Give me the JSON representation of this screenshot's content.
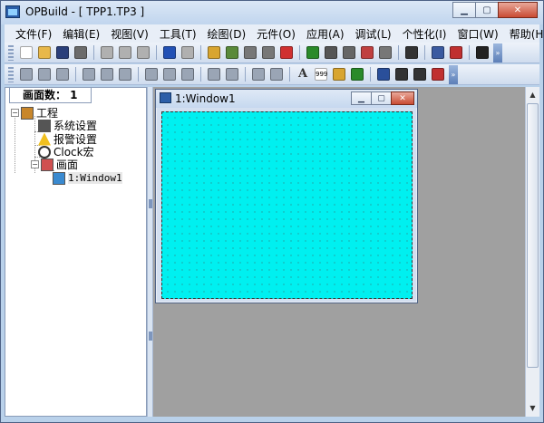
{
  "window": {
    "title": "OPBuild - [ TPP1.TP3 ]"
  },
  "window_controls": {
    "minimize": "▁",
    "maximize": "▢",
    "close": "✕"
  },
  "menu": [
    "文件(F)",
    "编辑(E)",
    "视图(V)",
    "工具(T)",
    "绘图(D)",
    "元件(O)",
    "应用(A)",
    "调试(L)",
    "个性化(I)",
    "窗口(W)",
    "帮助(H)"
  ],
  "toolbar1": {
    "buttons": [
      {
        "name": "new-file-icon",
        "color": "#ffffff"
      },
      {
        "name": "open-folder-icon",
        "color": "#e8b84a"
      },
      {
        "name": "save-icon",
        "color": "#2a3f7a"
      },
      {
        "name": "print-icon",
        "color": "#6b6b6b"
      },
      {
        "name": "cut-icon",
        "color": "#b0b0b0"
      },
      {
        "name": "copy-icon",
        "color": "#b0b0b0"
      },
      {
        "name": "paste-icon",
        "color": "#b0b0b0"
      },
      {
        "name": "undo-icon",
        "color": "#2251b5"
      },
      {
        "name": "redo-icon",
        "color": "#b0b0b0"
      },
      {
        "name": "component-a-icon",
        "color": "#d8a530"
      },
      {
        "name": "component-b-icon",
        "color": "#5a8a3a"
      },
      {
        "name": "component-c-icon",
        "color": "#777777"
      },
      {
        "name": "component-d-icon",
        "color": "#777777"
      },
      {
        "name": "delete-component-icon",
        "color": "#d03030"
      },
      {
        "name": "compile-icon",
        "color": "#2a8a2a"
      },
      {
        "name": "tools-icon",
        "color": "#555555"
      },
      {
        "name": "settings-a-icon",
        "color": "#666666"
      },
      {
        "name": "settings-b-icon",
        "color": "#c04040"
      },
      {
        "name": "link-icon",
        "color": "#777777"
      },
      {
        "name": "clock-icon",
        "color": "#333333"
      },
      {
        "name": "keyboard-icon",
        "color": "#3a5aa0"
      },
      {
        "name": "download-icon",
        "color": "#c03030"
      },
      {
        "name": "grid-icon",
        "color": "#222222"
      }
    ]
  },
  "toolbar2": {
    "buttons": [
      {
        "name": "align-left-icon",
        "color": "#9aa5b5"
      },
      {
        "name": "align-center-icon",
        "color": "#9aa5b5"
      },
      {
        "name": "align-right-icon",
        "color": "#9aa5b5"
      },
      {
        "name": "align-top-icon",
        "color": "#9aa5b5"
      },
      {
        "name": "align-middle-icon",
        "color": "#9aa5b5"
      },
      {
        "name": "align-bottom-icon",
        "color": "#9aa5b5"
      },
      {
        "name": "same-width-icon",
        "color": "#9aa5b5"
      },
      {
        "name": "same-height-icon",
        "color": "#9aa5b5"
      },
      {
        "name": "same-size-icon",
        "color": "#9aa5b5"
      },
      {
        "name": "lock-icon",
        "color": "#9aa5b5"
      },
      {
        "name": "unlock-icon",
        "color": "#9aa5b5"
      },
      {
        "name": "bring-front-icon",
        "color": "#9aa5b5"
      },
      {
        "name": "send-back-icon",
        "color": "#9aa5b5"
      },
      {
        "name": "text-icon",
        "color": "#222222"
      },
      {
        "name": "numeric-display-icon",
        "color": "#333333"
      },
      {
        "name": "button-component-icon",
        "color": "#d8a530"
      },
      {
        "name": "lamp-icon",
        "color": "#2a8a2a"
      },
      {
        "name": "trend-chart-icon",
        "color": "#2a4f9a"
      },
      {
        "name": "bar-graph-icon",
        "color": "#333333"
      },
      {
        "name": "meter-icon",
        "color": "#333333"
      },
      {
        "name": "function-key-icon",
        "color": "#c03030"
      }
    ],
    "text_button_label": "A",
    "numeric_button_label": "999"
  },
  "tree_panel": {
    "tab_label": "画面数：  1",
    "nodes": [
      {
        "label": "工程",
        "icon": "house-icon",
        "depth": 0,
        "expander": "−"
      },
      {
        "label": "系统设置",
        "icon": "wrench-icon",
        "depth": 1
      },
      {
        "label": "报警设置",
        "icon": "warning-icon",
        "depth": 1
      },
      {
        "label": "Clock宏",
        "icon": "clock-icon",
        "depth": 1
      },
      {
        "label": "画面",
        "icon": "screens-icon",
        "depth": 1,
        "expander": "−"
      },
      {
        "label": "1:Window1",
        "icon": "image-icon",
        "depth": 2,
        "selected": true
      }
    ]
  },
  "child_window": {
    "title": "1:Window1"
  },
  "colors": {
    "canvas": "#00f0f0",
    "workspace": "#a0a0a0",
    "chrome": "#b9d1ea"
  }
}
